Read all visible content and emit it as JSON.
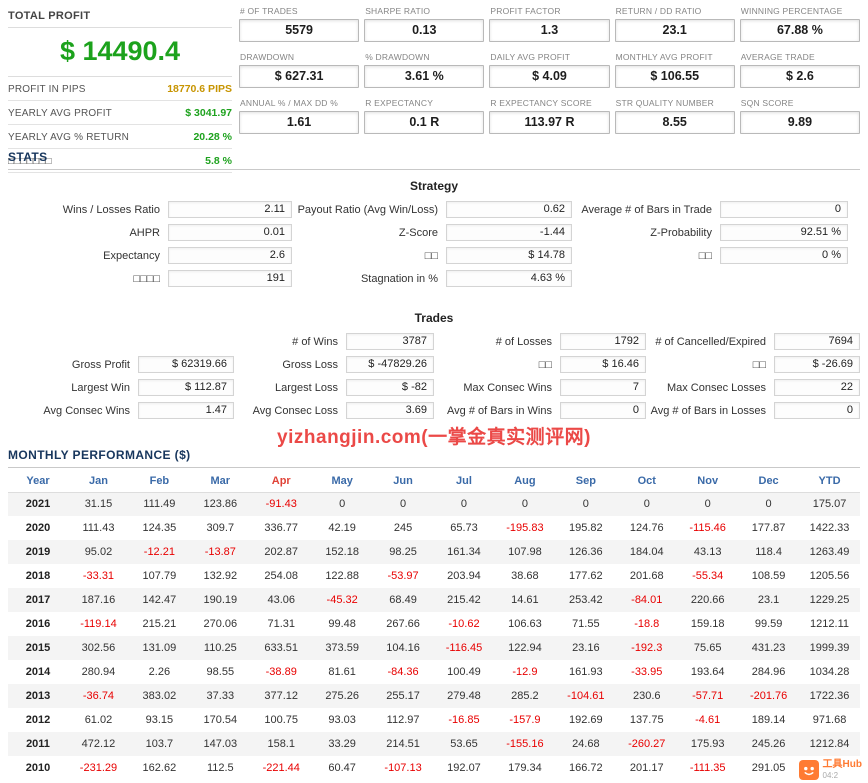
{
  "colors": {
    "green": "#1ea21e",
    "gold": "#c79400",
    "negative_red": "#e80000",
    "navy": "#17365d",
    "header_blue": "#3a6aa8",
    "watermark_red": "#e8302d",
    "badge_orange": "#ff7b33"
  },
  "summary": {
    "title": "TOTAL PROFIT",
    "total": "$ 14490.4",
    "rows": [
      {
        "label": "PROFIT IN PIPS",
        "value": "18770.6 PIPS",
        "color": "gold"
      },
      {
        "label": "YEARLY AVG PROFIT",
        "value": "$ 3041.97",
        "color": "green"
      },
      {
        "label": "YEARLY AVG % RETURN",
        "value": "20.28 %",
        "color": "green"
      },
      {
        "label": "□□□□□□□",
        "value": "5.8 %",
        "color": "green"
      }
    ]
  },
  "metrics": [
    {
      "label": "# OF TRADES",
      "value": "5579"
    },
    {
      "label": "SHARPE RATIO",
      "value": "0.13"
    },
    {
      "label": "PROFIT FACTOR",
      "value": "1.3"
    },
    {
      "label": "RETURN / DD RATIO",
      "value": "23.1"
    },
    {
      "label": "WINNING PERCENTAGE",
      "value": "67.88 %"
    },
    {
      "label": "DRAWDOWN",
      "value": "$ 627.31"
    },
    {
      "label": "% DRAWDOWN",
      "value": "3.61 %"
    },
    {
      "label": "DAILY AVG PROFIT",
      "value": "$ 4.09"
    },
    {
      "label": "MONTHLY AVG PROFIT",
      "value": "$ 106.55"
    },
    {
      "label": "AVERAGE TRADE",
      "value": "$ 2.6"
    },
    {
      "label": "ANNUAL % / MAX DD %",
      "value": "1.61"
    },
    {
      "label": "R EXPECTANCY",
      "value": "0.1 R"
    },
    {
      "label": "R EXPECTANCY SCORE",
      "value": "113.97 R"
    },
    {
      "label": "STR QUALITY NUMBER",
      "value": "8.55"
    },
    {
      "label": "SQN SCORE",
      "value": "9.89"
    }
  ],
  "stats": {
    "section_title": "STATS",
    "strategy": {
      "title": "Strategy",
      "rows": [
        [
          {
            "label": "Wins / Losses Ratio",
            "value": "2.11"
          },
          {
            "label": "Payout Ratio (Avg Win/Loss)",
            "value": "0.62"
          },
          {
            "label": "Average # of Bars in Trade",
            "value": "0"
          }
        ],
        [
          {
            "label": "AHPR",
            "value": "0.01"
          },
          {
            "label": "Z-Score",
            "value": "-1.44"
          },
          {
            "label": "Z-Probability",
            "value": "92.51 %"
          }
        ],
        [
          {
            "label": "Expectancy",
            "value": "2.6"
          },
          {
            "label": "□□",
            "value": "$ 14.78"
          },
          {
            "label": "□□",
            "value": "0 %"
          }
        ],
        [
          {
            "label": "□□□□",
            "value": "191"
          },
          {
            "label": "Stagnation in %",
            "value": "4.63 %"
          },
          null
        ]
      ]
    },
    "trades": {
      "title": "Trades",
      "rows": [
        [
          null,
          {
            "label": "# of Wins",
            "value": "3787"
          },
          {
            "label": "# of Losses",
            "value": "1792"
          },
          {
            "label": "# of Cancelled/Expired",
            "value": "7694"
          }
        ],
        [
          {
            "label": "Gross Profit",
            "value": "$ 62319.66"
          },
          {
            "label": "Gross Loss",
            "value": "$ -47829.26"
          },
          {
            "label": "□□",
            "value": "$ 16.46"
          },
          {
            "label": "□□",
            "value": "$ -26.69"
          }
        ],
        [
          {
            "label": "Largest Win",
            "value": "$ 112.87"
          },
          {
            "label": "Largest Loss",
            "value": "$ -82"
          },
          {
            "label": "Max Consec Wins",
            "value": "7"
          },
          {
            "label": "Max Consec Losses",
            "value": "22"
          }
        ],
        [
          {
            "label": "Avg Consec Wins",
            "value": "1.47"
          },
          {
            "label": "Avg Consec Loss",
            "value": "3.69"
          },
          {
            "label": "Avg # of Bars in Wins",
            "value": "0"
          },
          {
            "label": "Avg # of Bars in Losses",
            "value": "0"
          }
        ]
      ]
    }
  },
  "watermark": "yizhangjin.com(一掌金真实测评网)",
  "monthly": {
    "section_title": "MONTHLY PERFORMANCE ($)",
    "columns": [
      "Year",
      "Jan",
      "Feb",
      "Mar",
      "Apr",
      "May",
      "Jun",
      "Jul",
      "Aug",
      "Sep",
      "Oct",
      "Nov",
      "Dec",
      "YTD"
    ],
    "highlight_column": "Apr",
    "rows": [
      {
        "year": "2021",
        "values": [
          "31.15",
          "111.49",
          "123.86",
          "-91.43",
          "0",
          "0",
          "0",
          "0",
          "0",
          "0",
          "0",
          "0",
          "175.07"
        ]
      },
      {
        "year": "2020",
        "values": [
          "111.43",
          "124.35",
          "309.7",
          "336.77",
          "42.19",
          "245",
          "65.73",
          "-195.83",
          "195.82",
          "124.76",
          "-115.46",
          "177.87",
          "1422.33"
        ]
      },
      {
        "year": "2019",
        "values": [
          "95.02",
          "-12.21",
          "-13.87",
          "202.87",
          "152.18",
          "98.25",
          "161.34",
          "107.98",
          "126.36",
          "184.04",
          "43.13",
          "118.4",
          "1263.49"
        ]
      },
      {
        "year": "2018",
        "values": [
          "-33.31",
          "107.79",
          "132.92",
          "254.08",
          "122.88",
          "-53.97",
          "203.94",
          "38.68",
          "177.62",
          "201.68",
          "-55.34",
          "108.59",
          "1205.56"
        ]
      },
      {
        "year": "2017",
        "values": [
          "187.16",
          "142.47",
          "190.19",
          "43.06",
          "-45.32",
          "68.49",
          "215.42",
          "14.61",
          "253.42",
          "-84.01",
          "220.66",
          "23.1",
          "1229.25"
        ]
      },
      {
        "year": "2016",
        "values": [
          "-119.14",
          "215.21",
          "270.06",
          "71.31",
          "99.48",
          "267.66",
          "-10.62",
          "106.63",
          "71.55",
          "-18.8",
          "159.18",
          "99.59",
          "1212.11"
        ]
      },
      {
        "year": "2015",
        "values": [
          "302.56",
          "131.09",
          "110.25",
          "633.51",
          "373.59",
          "104.16",
          "-116.45",
          "122.94",
          "23.16",
          "-192.3",
          "75.65",
          "431.23",
          "1999.39"
        ]
      },
      {
        "year": "2014",
        "values": [
          "280.94",
          "2.26",
          "98.55",
          "-38.89",
          "81.61",
          "-84.36",
          "100.49",
          "-12.9",
          "161.93",
          "-33.95",
          "193.64",
          "284.96",
          "1034.28"
        ]
      },
      {
        "year": "2013",
        "values": [
          "-36.74",
          "383.02",
          "37.33",
          "377.12",
          "275.26",
          "255.17",
          "279.48",
          "285.2",
          "-104.61",
          "230.6",
          "-57.71",
          "-201.76",
          "1722.36"
        ]
      },
      {
        "year": "2012",
        "values": [
          "61.02",
          "93.15",
          "170.54",
          "100.75",
          "93.03",
          "112.97",
          "-16.85",
          "-157.9",
          "192.69",
          "137.75",
          "-4.61",
          "189.14",
          "971.68"
        ]
      },
      {
        "year": "2011",
        "values": [
          "472.12",
          "103.7",
          "147.03",
          "158.1",
          "33.29",
          "214.51",
          "53.65",
          "-155.16",
          "24.68",
          "-260.27",
          "175.93",
          "245.26",
          "1212.84"
        ]
      },
      {
        "year": "2010",
        "values": [
          "-231.29",
          "162.62",
          "112.5",
          "-221.44",
          "60.47",
          "-107.13",
          "192.07",
          "179.34",
          "166.72",
          "201.17",
          "-111.35",
          "291.05",
          ""
        ]
      }
    ]
  },
  "badge": {
    "title": "工具Hub",
    "subtitle": "04:2"
  }
}
